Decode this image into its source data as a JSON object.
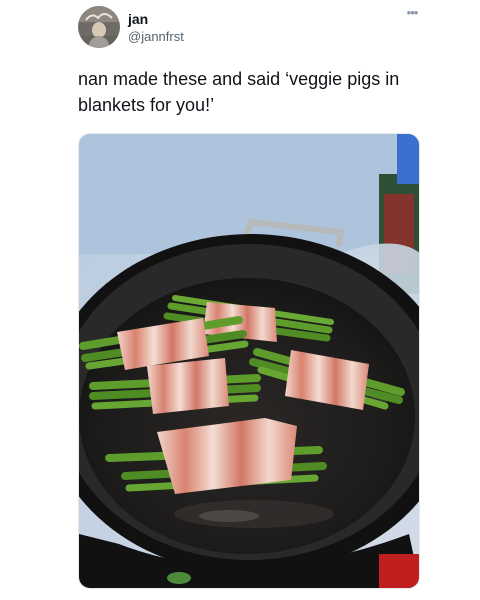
{
  "user": {
    "display_name": "jan",
    "handle": "@jannfrst"
  },
  "more_icon": "more-options-icon",
  "tweet": {
    "text": "nan made these and said ‘veggie pigs in blankets for you!’"
  },
  "media": {
    "icon": "photo"
  },
  "colors": {
    "text": "#0f1419",
    "secondary": "#536471"
  }
}
